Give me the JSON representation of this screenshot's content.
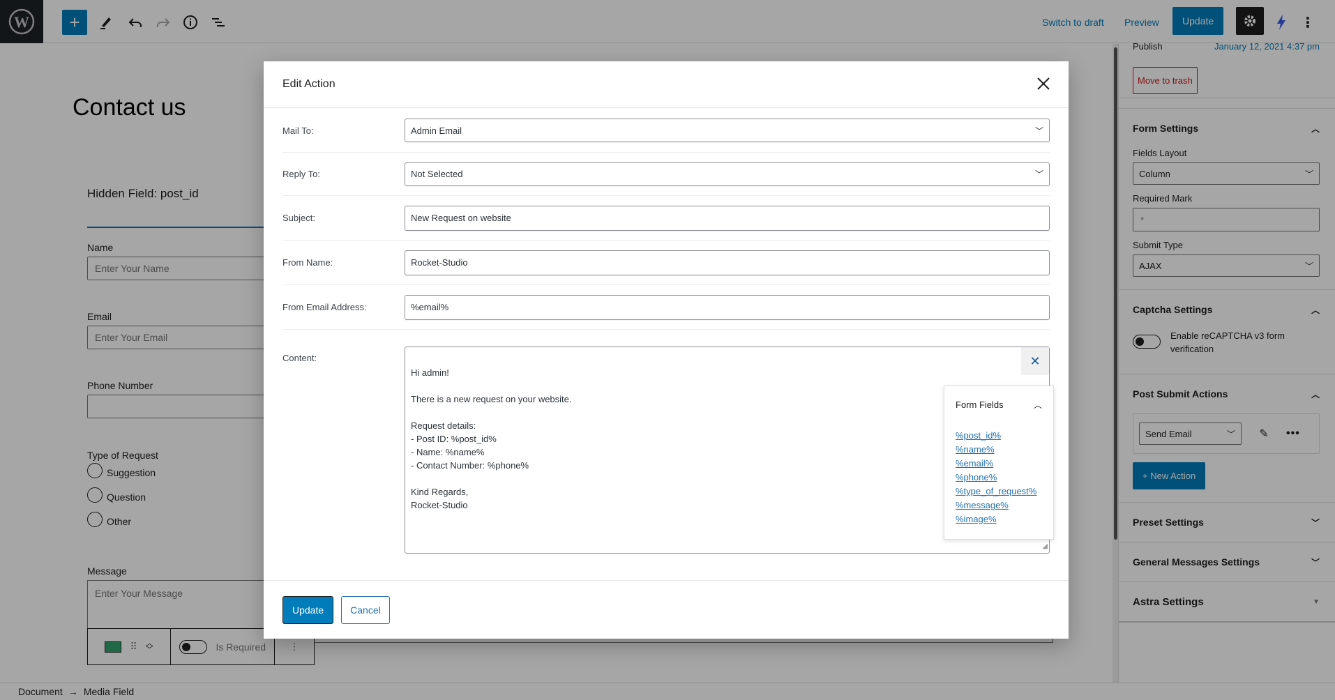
{
  "topbar": {
    "switch_to_draft": "Switch to draft",
    "preview": "Preview",
    "update": "Update"
  },
  "editor": {
    "page_title": "Contact us",
    "hidden_field": "Hidden Field: post_id",
    "fields": [
      {
        "label": "Name",
        "placeholder": "Enter Your Name"
      },
      {
        "label": "Email",
        "placeholder": "Enter Your Email"
      },
      {
        "label": "Phone Number",
        "placeholder": ""
      }
    ],
    "radio_group": {
      "label": "Type of Request",
      "options": [
        "Suggestion",
        "Question",
        "Other"
      ]
    },
    "message": {
      "label": "Message",
      "placeholder": "Enter Your Message"
    },
    "block_toolbar": {
      "is_required_label": "Is Required"
    }
  },
  "breadcrumb": {
    "items": [
      "Document",
      "Media Field"
    ],
    "separator": "→"
  },
  "sidebar": {
    "publish_label": "Publish",
    "publish_date": "January 12, 2021 4:37 pm",
    "move_to_trash": "Move to trash",
    "form_settings": {
      "title": "Form Settings",
      "fields_layout_label": "Fields Layout",
      "fields_layout_value": "Column",
      "required_mark_label": "Required Mark",
      "required_mark_value": "*",
      "submit_type_label": "Submit Type",
      "submit_type_value": "AJAX"
    },
    "captcha_settings": {
      "title": "Captcha Settings",
      "toggle_label": "Enable reCAPTCHA v3 form verification"
    },
    "post_submit_actions": {
      "title": "Post Submit Actions",
      "action_value": "Send Email",
      "new_action": "+ New Action"
    },
    "preset_settings": "Preset Settings",
    "general_messages_settings": "General Messages Settings",
    "astra_settings": "Astra Settings"
  },
  "modal": {
    "title": "Edit Action",
    "rows": [
      {
        "label": "Mail To:",
        "value": "Admin Email",
        "type": "select"
      },
      {
        "label": "Reply To:",
        "value": "Not Selected",
        "type": "select"
      },
      {
        "label": "Subject:",
        "value": "New Request on website",
        "type": "input"
      },
      {
        "label": "From Name:",
        "value": "Rocket-Studio",
        "type": "input"
      },
      {
        "label": "From Email Address:",
        "value": "%email%",
        "type": "input"
      }
    ],
    "content_label": "Content:",
    "content_value": "Hi admin!\n\nThere is a new request on your website.\n\nRequest details:\n- Post ID: %post_id%\n- Name: %name%\n- Contact Number: %phone%\n\nKind Regards,\nRocket-Studio",
    "form_fields": {
      "title": "Form Fields",
      "items": [
        "%post_id%",
        "%name%",
        "%email%",
        "%phone%",
        "%type_of_request%",
        "%message%",
        "%image%"
      ]
    },
    "update_button": "Update",
    "cancel_button": "Cancel"
  },
  "colors": {
    "accent": "#007cba",
    "link": "#2271b1",
    "trash": "#b32d2e"
  }
}
